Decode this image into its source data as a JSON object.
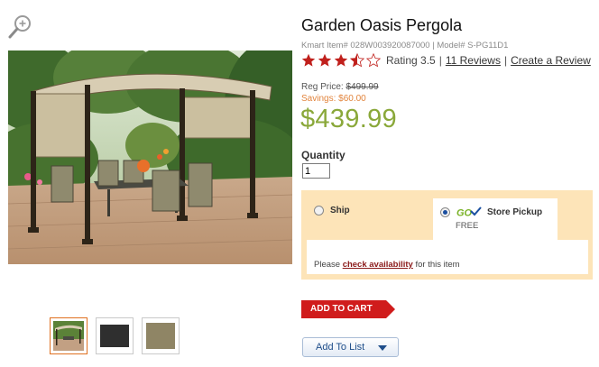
{
  "product": {
    "title": "Garden Oasis Pergola",
    "meta": "Kmart Item# 028W003920087000 | Model# S-PG11D1",
    "rating_value": 3.5,
    "rating_text": "Rating 3.5",
    "reviews_link": "11 Reviews",
    "separator": "|",
    "create_review_link": "Create a Review"
  },
  "pricing": {
    "reg_label": "Reg Price: ",
    "reg_value": "$499.99",
    "savings": "Savings: $60.00",
    "price": "$439.99",
    "price_color": "#8aa83a",
    "savings_color": "#e2843c"
  },
  "quantity": {
    "label": "Quantity",
    "value": "1"
  },
  "fulfillment": {
    "ship_label": "Ship",
    "pickup_label": "Store Pickup",
    "pickup_logo_text": "GO",
    "pickup_free": "FREE",
    "selected": "pickup",
    "avail_prefix": "Please ",
    "avail_link": "check availability",
    "avail_suffix": " for this item",
    "panel_color": "#fde4b8"
  },
  "actions": {
    "add_to_cart": "ADD TO CART",
    "add_to_list": "Add To List",
    "cart_color": "#d01c1c"
  },
  "icons": {
    "zoom": "magnifier-plus-icon",
    "dropdown": "caret-down-icon"
  }
}
